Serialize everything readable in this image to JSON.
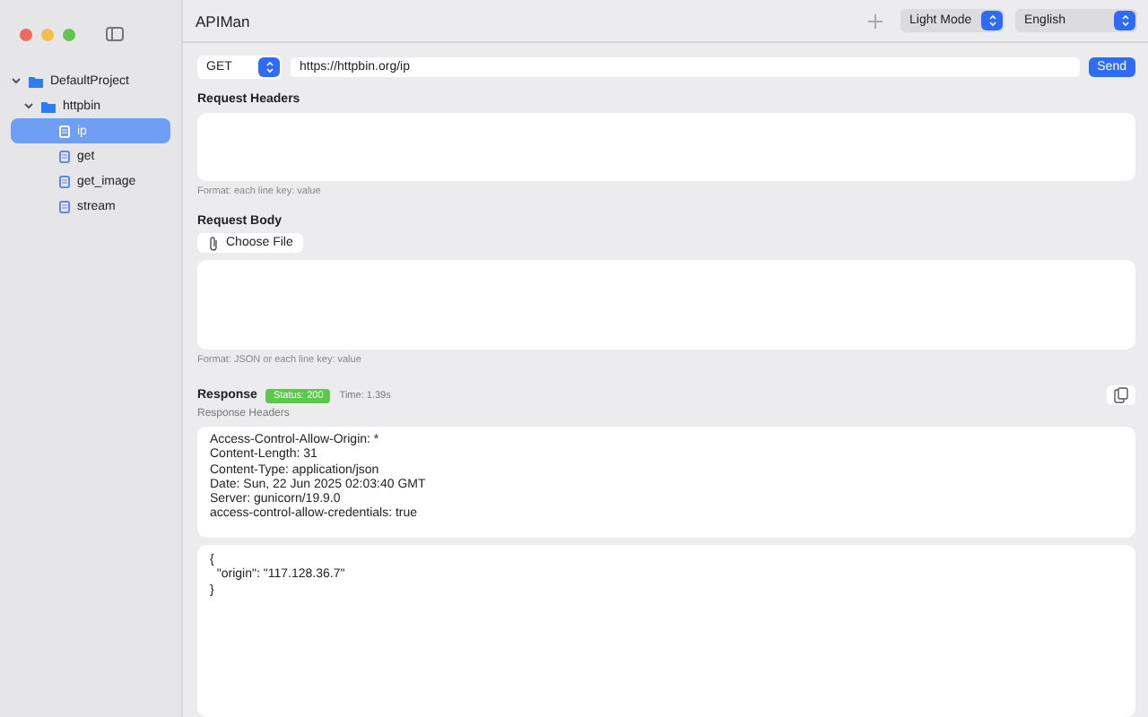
{
  "window": {
    "title": "APIMan"
  },
  "toolbar": {
    "theme_select": "Light Mode",
    "language_select": "English"
  },
  "sidebar": {
    "tree": [
      {
        "label": "DefaultProject",
        "kind": "folder",
        "expanded": true,
        "selected": false,
        "children": [
          {
            "label": "httpbin",
            "kind": "folder",
            "expanded": true,
            "selected": false,
            "children": [
              {
                "label": "ip",
                "kind": "request",
                "selected": true
              },
              {
                "label": "get",
                "kind": "request",
                "selected": false
              },
              {
                "label": "get_image",
                "kind": "request",
                "selected": false
              },
              {
                "label": "stream",
                "kind": "request",
                "selected": false
              }
            ]
          }
        ]
      }
    ]
  },
  "request": {
    "method": "GET",
    "url": "https://httpbin.org/ip",
    "send_button": "Send",
    "headers_title": "Request Headers",
    "headers_hint": "Format: each line key: value",
    "body_title": "Request Body",
    "choose_file_button": "Choose File",
    "body_hint": "Format: JSON or each line key: value"
  },
  "response": {
    "title": "Response",
    "status": "Status: 200",
    "time": "Time: 1.39s",
    "headers_title": "Response Headers",
    "headers": [
      "Access-Control-Allow-Origin: *",
      "Content-Length: 31",
      "Content-Type: application/json",
      "Date: Sun, 22 Jun 2025 02:03:40 GMT",
      "Server: gunicorn/19.9.0",
      "access-control-allow-credentials: true"
    ],
    "body": [
      "{",
      "  \"origin\": \"117.128.36.7\"",
      "}"
    ]
  }
}
